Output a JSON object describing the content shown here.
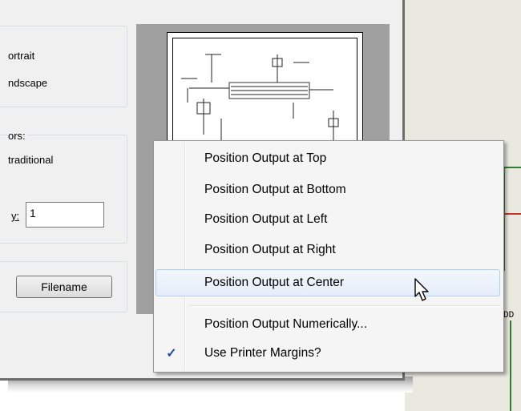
{
  "orientation": {
    "portrait_label": "ortrait",
    "landscape_label": "ndscape"
  },
  "colors_group": {
    "title": "ors:",
    "traditional_label": "traditional",
    "copies_label": "y:",
    "copies_value": "1"
  },
  "output": {
    "filename_button": "Filename"
  },
  "schematic": {
    "label": "DD"
  },
  "context_menu": {
    "items": [
      {
        "label": "Position Output at Top",
        "checked": false
      },
      {
        "label": "Position Output at Bottom",
        "checked": false
      },
      {
        "label": "Position Output at Left",
        "checked": false
      },
      {
        "label": "Position Output at Right",
        "checked": false
      },
      {
        "label": "Position Output at Center",
        "checked": false,
        "highlighted": true
      },
      {
        "label": "Position Output Numerically...",
        "checked": false
      },
      {
        "label": "Use Printer Margins?",
        "checked": true
      }
    ],
    "check_glyph": "✓"
  },
  "icons": [
    "checkmark-icon",
    "mouse-pointer-icon"
  ]
}
